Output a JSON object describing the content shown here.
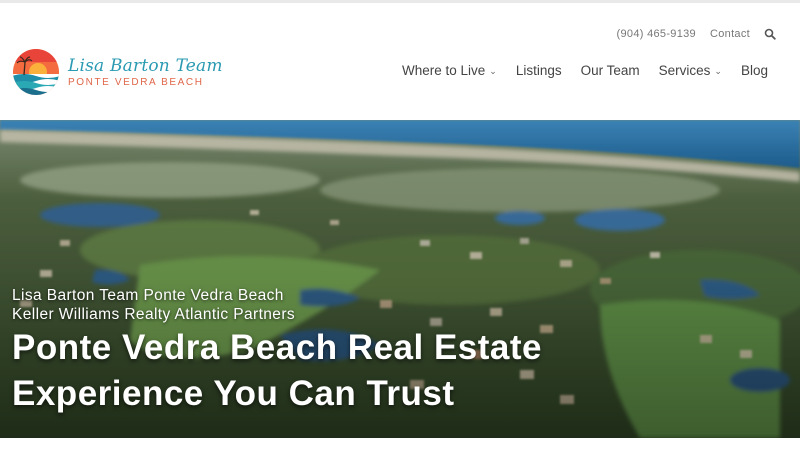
{
  "header": {
    "phone": "(904) 465-9139",
    "contact_label": "Contact",
    "search_icon": "search-icon"
  },
  "logo": {
    "name": "Lisa Barton Team",
    "place": "PONTE VEDRA BEACH",
    "icon": "beach-sunset-logo-icon",
    "colors": {
      "sun": "#f25a3a",
      "sea": "#1f8ea8",
      "name": "#2a9ab2",
      "place": "#e0674a"
    }
  },
  "nav": {
    "items": [
      {
        "label": "Where to Live",
        "has_dropdown": true
      },
      {
        "label": "Listings",
        "has_dropdown": false
      },
      {
        "label": "Our Team",
        "has_dropdown": false
      },
      {
        "label": "Services",
        "has_dropdown": true
      },
      {
        "label": "Blog",
        "has_dropdown": false
      }
    ]
  },
  "hero": {
    "subtitle_line1": "Lisa Barton Team Ponte Vedra Beach",
    "subtitle_line2": "Keller Williams Realty Atlantic Partners",
    "headline_line1": "Ponte Vedra Beach Real Estate",
    "headline_line2": "Experience You Can Trust"
  }
}
